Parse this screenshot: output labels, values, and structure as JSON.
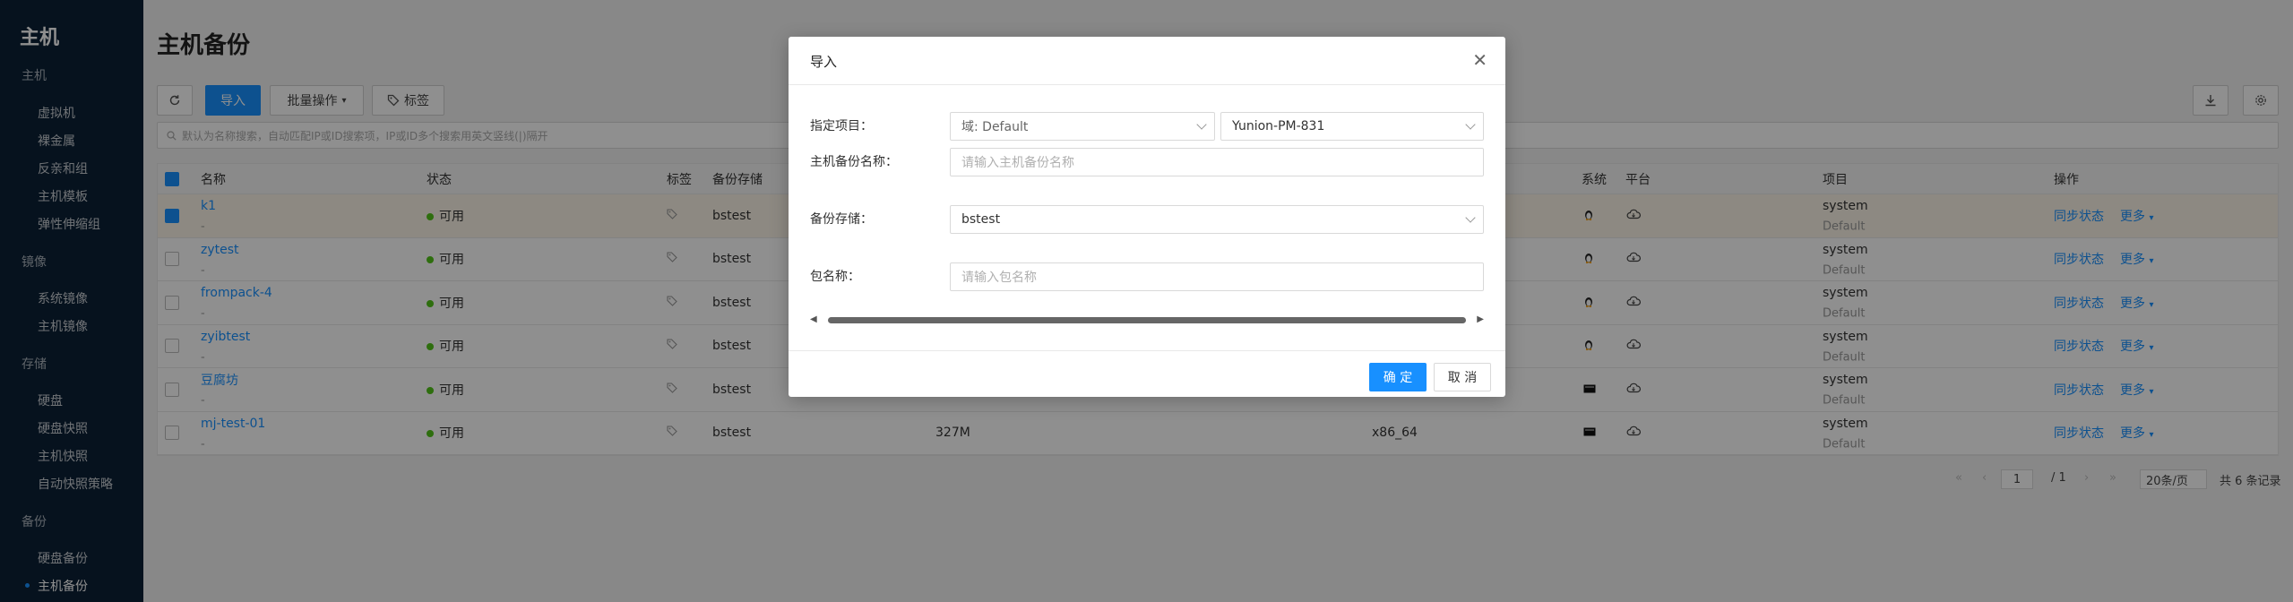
{
  "sidebar": {
    "title": "主机",
    "groups": [
      {
        "label": "主机",
        "items": [
          "虚拟机",
          "裸金属",
          "反亲和组",
          "主机模板",
          "弹性伸缩组"
        ]
      },
      {
        "label": "镜像",
        "items": [
          "系统镜像",
          "主机镜像"
        ]
      },
      {
        "label": "存储",
        "items": [
          "硬盘",
          "硬盘快照",
          "主机快照",
          "自动快照策略"
        ]
      },
      {
        "label": "备份",
        "items": [
          "硬盘备份",
          "主机备份"
        ]
      }
    ]
  },
  "page": {
    "title": "主机备份"
  },
  "toolbar": {
    "import_label": "导入",
    "batch_label": "批量操作",
    "tag_label": "标签"
  },
  "search": {
    "placeholder": "默认为名称搜索，自动匹配IP或ID搜索项，IP或ID多个搜索用英文竖线(|)隔开"
  },
  "table": {
    "headers": {
      "name": "名称",
      "status": "状态",
      "tags": "标签",
      "storage": "备份存储",
      "system": "系统",
      "platform": "平台",
      "project": "项目",
      "actions": "操作"
    },
    "rows": [
      {
        "name": "k1",
        "sub": "-",
        "status": "可用",
        "storage": "bstest",
        "size": "",
        "arch": "",
        "os": "linux",
        "project": "system",
        "domain": "Default",
        "sync": "同步状态",
        "more": "更多"
      },
      {
        "name": "zytest",
        "sub": "-",
        "status": "可用",
        "storage": "bstest",
        "size": "",
        "arch": "",
        "os": "linux",
        "project": "system",
        "domain": "Default",
        "sync": "同步状态",
        "more": "更多"
      },
      {
        "name": "frompack-4",
        "sub": "-",
        "status": "可用",
        "storage": "bstest",
        "size": "",
        "arch": "",
        "os": "linux",
        "project": "system",
        "domain": "Default",
        "sync": "同步状态",
        "more": "更多"
      },
      {
        "name": "zyibtest",
        "sub": "-",
        "status": "可用",
        "storage": "bstest",
        "size": "",
        "arch": "",
        "os": "linux",
        "project": "system",
        "domain": "Default",
        "sync": "同步状态",
        "more": "更多"
      },
      {
        "name": "豆腐坊",
        "sub": "-",
        "status": "可用",
        "storage": "bstest",
        "size": "",
        "arch": "",
        "os": "other",
        "project": "system",
        "domain": "Default",
        "sync": "同步状态",
        "more": "更多"
      },
      {
        "name": "mj-test-01",
        "sub": "-",
        "status": "可用",
        "storage": "bstest",
        "size": "327M",
        "arch": "x86_64",
        "os": "other",
        "project": "system",
        "domain": "Default",
        "sync": "同步状态",
        "more": "更多"
      }
    ]
  },
  "pager": {
    "page": "1",
    "total_pages": "/ 1",
    "page_size": "20条/页",
    "total": "共 6 条记录"
  },
  "modal": {
    "title": "导入",
    "project_label": "指定项目：",
    "domain_value": "域: Default",
    "project_value": "Yunion-PM-831",
    "name_label": "主机备份名称：",
    "name_placeholder": "请输入主机备份名称",
    "storage_label": "备份存储：",
    "storage_value": "bstest",
    "package_label": "包名称：",
    "package_placeholder": "请输入包名称",
    "ok_label": "确 定",
    "cancel_label": "取 消"
  },
  "colors": {
    "accent": "#1890ff",
    "sidebar": "#0c2136",
    "status_ok": "#52c41a"
  }
}
